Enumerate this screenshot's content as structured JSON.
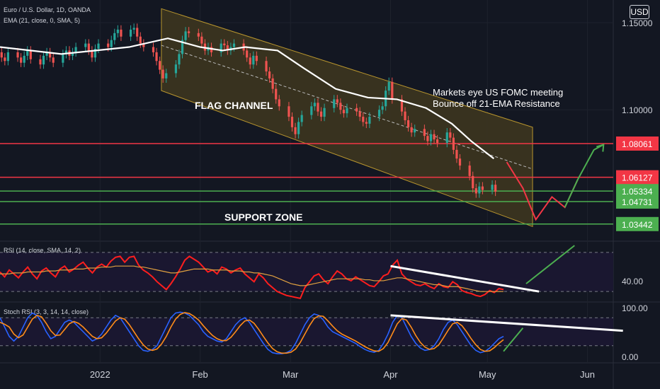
{
  "header": {
    "symbol": "Euro / U.S. Dollar, 1D, OANDA",
    "ema": "EMA (21, close, 0, SMA, 5)",
    "currency": "USD"
  },
  "chart_data": [
    {
      "type": "candlestick",
      "title": "Euro / U.S. Dollar, 1D, OANDA",
      "ylim": [
        1.025,
        1.163
      ],
      "xlim": [
        "2021-12-01",
        "2022-06-09"
      ],
      "y_ticks": [
        "1.15000",
        "1.10000"
      ],
      "x_ticks": [
        "2022",
        "Feb",
        "Mar",
        "Apr",
        "May",
        "Jun"
      ],
      "price_levels": [
        {
          "value": 1.08061,
          "label": "1.08061",
          "color": "#f23645"
        },
        {
          "value": 1.06127,
          "label": "1.06127",
          "color": "#f23645"
        },
        {
          "value": 1.05334,
          "label": "1.05334",
          "color": "#4caf50"
        },
        {
          "value": 1.04731,
          "label": "1.04731",
          "color": "#4caf50"
        },
        {
          "value": 1.03442,
          "label": "1.03442",
          "color": "#4caf50"
        }
      ],
      "annotations": [
        "FLAG CHANNEL",
        "Markets eye US FOMC meeting",
        "Bounce off 21-EMA Resistance",
        "SUPPORT ZONE"
      ],
      "ema_series": {
        "name": "EMA (21, close, 0, SMA, 5)",
        "x": [
          "2021-12-01",
          "2021-12-20",
          "2022-01-10",
          "2022-01-22",
          "2022-02-01",
          "2022-02-08",
          "2022-02-15",
          "2022-02-25",
          "2022-03-05",
          "2022-03-15",
          "2022-03-25",
          "2022-04-03",
          "2022-04-12",
          "2022-04-20",
          "2022-04-26",
          "2022-05-03"
        ],
        "values": [
          1.136,
          1.132,
          1.136,
          1.141,
          1.136,
          1.134,
          1.136,
          1.134,
          1.124,
          1.112,
          1.107,
          1.106,
          1.101,
          1.092,
          1.082,
          1.072
        ]
      },
      "candles": {
        "x_start": "2021-12-01",
        "close": [
          1.13,
          1.128,
          1.133,
          1.13,
          1.127,
          1.131,
          1.134,
          1.129,
          1.126,
          1.131,
          1.133,
          1.13,
          1.127,
          1.132,
          1.134,
          1.131,
          1.133,
          1.136,
          1.138,
          1.134,
          1.13,
          1.135,
          1.138,
          1.136,
          1.14,
          1.144,
          1.146,
          1.142,
          1.146,
          1.147,
          1.142,
          1.138,
          1.136,
          1.133,
          1.128,
          1.123,
          1.118,
          1.121,
          1.126,
          1.132,
          1.14,
          1.145,
          1.144,
          1.142,
          1.138,
          1.134,
          1.136,
          1.133,
          1.138,
          1.137,
          1.134,
          1.136,
          1.138,
          1.134,
          1.13,
          1.126,
          1.131,
          1.128,
          1.122,
          1.118,
          1.112,
          1.106,
          1.102,
          1.096,
          1.09,
          1.086,
          1.093,
          1.097,
          1.102,
          1.104,
          1.099,
          1.096,
          1.101,
          1.106,
          1.104,
          1.1,
          1.098,
          1.101,
          1.099,
          1.096,
          1.093,
          1.092,
          1.096,
          1.1,
          1.102,
          1.111,
          1.116,
          1.106,
          1.099,
          1.094,
          1.09,
          1.087,
          1.089,
          1.085,
          1.082,
          1.086,
          1.083,
          1.081,
          1.087,
          1.084,
          1.077,
          1.072,
          1.068,
          1.062,
          1.055,
          1.052,
          1.056,
          1.054,
          1.057,
          1.053
        ]
      },
      "projection": [
        1.07,
        1.055,
        1.037,
        1.05,
        1.044,
        1.06,
        1.077,
        1.08
      ]
    },
    {
      "type": "line",
      "title": "RSI (14, close, SMA, 14, 2)",
      "ylim": [
        20,
        80
      ],
      "y_ticks": [
        "40.00"
      ],
      "series": [
        {
          "name": "RSI",
          "values": [
            50,
            45,
            52,
            48,
            44,
            50,
            55,
            48,
            43,
            51,
            54,
            49,
            45,
            53,
            56,
            50,
            53,
            57,
            60,
            54,
            49,
            55,
            58,
            55,
            61,
            65,
            66,
            60,
            65,
            66,
            57,
            52,
            49,
            45,
            40,
            36,
            32,
            38,
            45,
            53,
            62,
            66,
            63,
            60,
            55,
            50,
            52,
            48,
            55,
            53,
            49,
            52,
            54,
            48,
            44,
            40,
            48,
            44,
            38,
            34,
            30,
            28,
            26,
            25,
            24,
            23,
            34,
            40,
            46,
            48,
            42,
            38,
            45,
            51,
            48,
            43,
            41,
            45,
            42,
            39,
            36,
            35,
            40,
            46,
            48,
            57,
            62,
            48,
            43,
            40,
            37,
            36,
            38,
            35,
            33,
            38,
            35,
            34,
            40,
            37,
            31,
            29,
            28,
            26,
            25,
            27,
            31,
            29,
            33,
            32
          ]
        },
        {
          "name": "MA",
          "values": [
            48,
            48,
            48,
            49,
            49,
            49,
            50,
            50,
            50,
            50,
            51,
            51,
            51,
            52,
            52,
            52,
            53,
            53,
            53,
            54,
            54,
            54,
            55,
            55,
            55,
            56,
            56,
            56,
            56,
            56,
            55,
            55,
            54,
            53,
            52,
            51,
            50,
            49,
            49,
            50,
            51,
            52,
            53,
            53,
            53,
            53,
            52,
            52,
            52,
            52,
            51,
            51,
            51,
            50,
            50,
            49,
            49,
            48,
            47,
            46,
            44,
            42,
            40,
            38,
            37,
            36,
            36,
            37,
            38,
            39,
            40,
            41,
            42,
            43,
            43,
            43,
            43,
            43,
            43,
            42,
            42,
            41,
            41,
            41,
            42,
            43,
            44,
            44,
            43,
            42,
            41,
            40,
            39,
            38,
            37,
            37,
            36,
            35,
            35,
            35,
            34,
            33,
            32,
            31,
            30,
            30,
            30,
            30,
            30,
            30
          ]
        }
      ]
    },
    {
      "type": "line",
      "title": "Stoch RSI (3, 3, 14, 14, close)",
      "ylim": [
        0,
        100
      ],
      "y_ticks": [
        "100.00",
        "0.00"
      ],
      "series": [
        {
          "name": "K",
          "values": [
            80,
            60,
            40,
            30,
            40,
            60,
            80,
            90,
            85,
            70,
            50,
            35,
            40,
            55,
            70,
            75,
            70,
            60,
            50,
            40,
            30,
            35,
            45,
            60,
            75,
            85,
            80,
            65,
            50,
            35,
            20,
            10,
            8,
            12,
            20,
            40,
            60,
            80,
            90,
            92,
            90,
            85,
            75,
            65,
            50,
            40,
            35,
            30,
            28,
            35,
            50,
            65,
            75,
            80,
            70,
            55,
            40,
            25,
            12,
            5,
            3,
            3,
            5,
            10,
            25,
            45,
            65,
            80,
            88,
            85,
            75,
            60,
            50,
            45,
            40,
            35,
            30,
            25,
            18,
            12,
            8,
            6,
            10,
            25,
            45,
            70,
            85,
            80,
            60,
            40,
            25,
            15,
            10,
            12,
            20,
            35,
            55,
            70,
            75,
            65,
            50,
            35,
            20,
            10,
            5,
            8,
            15,
            25,
            35,
            40
          ]
        },
        {
          "name": "D",
          "values": [
            70,
            66,
            60,
            45,
            37,
            43,
            60,
            77,
            85,
            82,
            68,
            52,
            42,
            43,
            55,
            67,
            72,
            68,
            60,
            50,
            40,
            35,
            37,
            47,
            60,
            73,
            80,
            77,
            65,
            50,
            35,
            22,
            13,
            10,
            13,
            24,
            40,
            60,
            77,
            87,
            91,
            89,
            83,
            75,
            63,
            52,
            42,
            35,
            31,
            31,
            38,
            50,
            63,
            73,
            75,
            68,
            55,
            40,
            26,
            14,
            7,
            4,
            4,
            6,
            13,
            27,
            45,
            63,
            78,
            84,
            83,
            73,
            62,
            52,
            45,
            40,
            35,
            30,
            24,
            18,
            13,
            9,
            8,
            14,
            27,
            47,
            67,
            78,
            75,
            60,
            42,
            27,
            17,
            12,
            14,
            22,
            37,
            53,
            67,
            70,
            63,
            50,
            35,
            22,
            12,
            8,
            9,
            16,
            25,
            33
          ]
        }
      ]
    }
  ]
}
